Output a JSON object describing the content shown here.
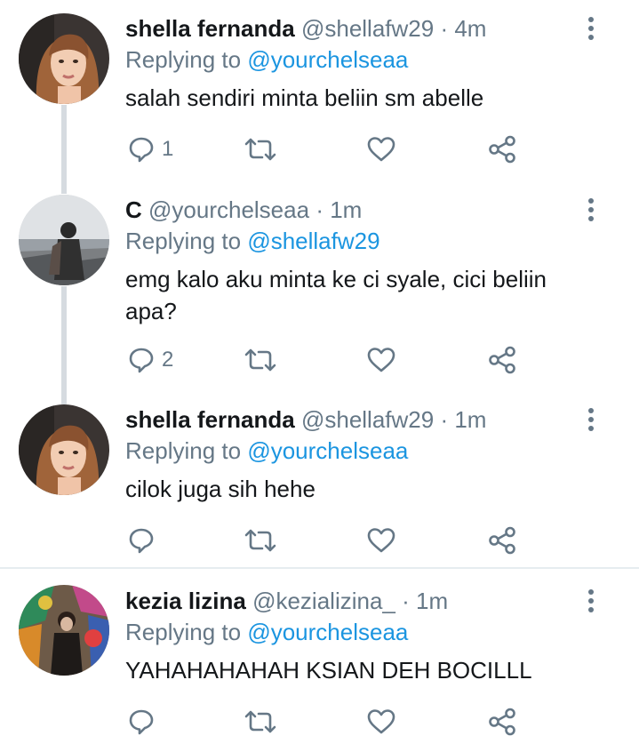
{
  "tweets": [
    {
      "name": "shella fernanda",
      "handle": "@shellafw29",
      "time": "· 4m",
      "replying_prefix": "Replying to",
      "replying_to": "@yourchelseaa",
      "text": "salah sendiri minta beliin sm abelle",
      "reply_count": "1",
      "avatar": "avatar-photo-shella"
    },
    {
      "name": "C",
      "handle": "@yourchelseaa",
      "time": "· 1m",
      "replying_prefix": "Replying to",
      "replying_to": "@shellafw29",
      "text": "emg kalo aku minta ke ci syale, cici beliin apa?",
      "reply_count": "2",
      "avatar": "avatar-photo-c"
    },
    {
      "name": "shella fernanda",
      "handle": "@shellafw29",
      "time": "· 1m",
      "replying_prefix": "Replying to",
      "replying_to": "@yourchelseaa",
      "text": "cilok juga sih hehe",
      "reply_count": "",
      "avatar": "avatar-photo-shella"
    },
    {
      "name": "kezia lizina",
      "handle": "@kezializina_",
      "time": "· 1m",
      "replying_prefix": "Replying to",
      "replying_to": "@yourchelseaa",
      "text": "YAHAHAHAHAH KSIAN DEH BOCILLL",
      "reply_count": "",
      "avatar": "avatar-photo-kezia"
    }
  ],
  "icons": {
    "reply": "reply-icon",
    "retweet": "retweet-icon",
    "like": "like-icon",
    "share": "share-icon",
    "more": "more-vertical-icon"
  },
  "colors": {
    "text": "#14171a",
    "secondary": "#657786",
    "link": "#1b95e0",
    "thread_line": "#d6dbe0",
    "divider": "#e6ecf0"
  }
}
